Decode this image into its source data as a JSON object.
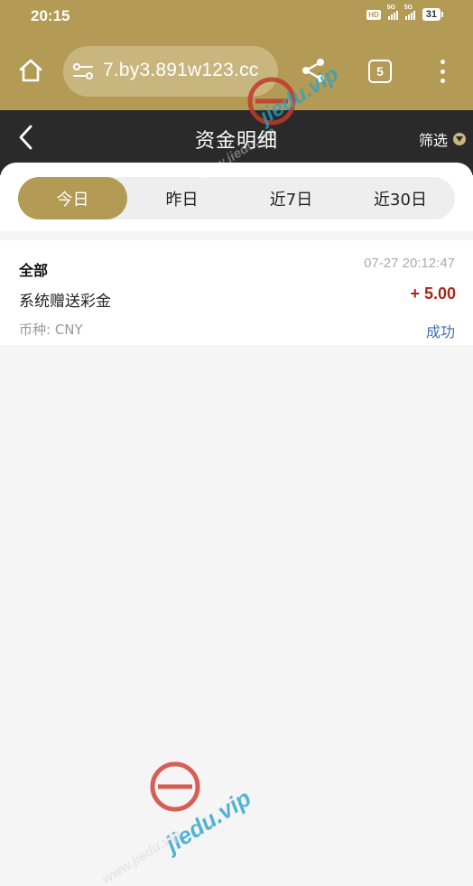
{
  "status_bar": {
    "time": "20:15",
    "hd_badge": "HD",
    "signal1_tag": "5G",
    "signal2_tag": "5G",
    "battery": "31"
  },
  "browser": {
    "url": "7.by3.891w123.cc",
    "tab_count": "5",
    "icons": [
      "home-icon",
      "site-settings-icon",
      "share-icon",
      "tabs-icon",
      "more-vert-icon"
    ]
  },
  "header": {
    "title": "资金明细",
    "filter_label": "筛选"
  },
  "tabs": [
    {
      "label": "今日",
      "active": true
    },
    {
      "label": "昨日",
      "active": false
    },
    {
      "label": "近7日",
      "active": false
    },
    {
      "label": "近30日",
      "active": false
    }
  ],
  "records": [
    {
      "type": "全部",
      "time": "07-27 20:12:47",
      "description": "系统赠送彩金",
      "amount": "+ 5.00",
      "currency": "币种: CNY",
      "status": "成功"
    }
  ],
  "watermark": {
    "site": "jiedu.vip",
    "url_text": "www.jiedu.vip"
  },
  "colors": {
    "brand_gold": "#b39a55",
    "header_dark": "#2a2a2a",
    "amount_red": "#a8261b",
    "status_blue": "#3f6fb0"
  }
}
